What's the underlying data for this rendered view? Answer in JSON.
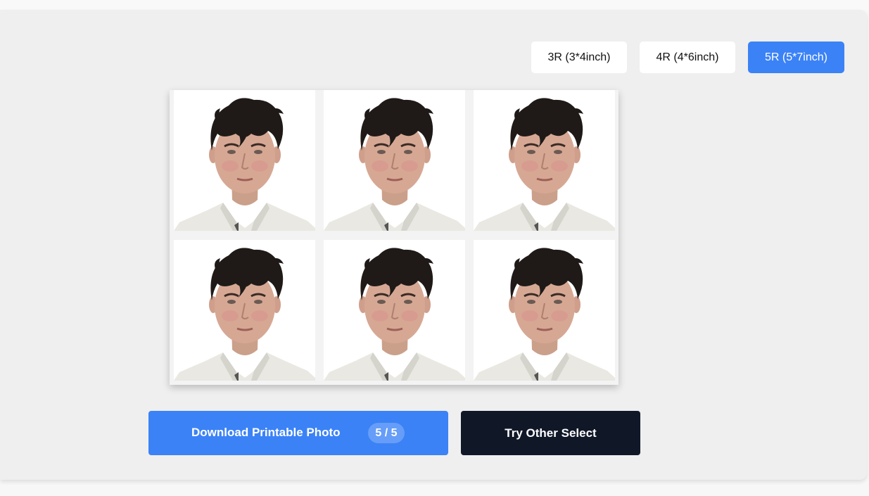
{
  "size_options": [
    {
      "label": "3R (3*4inch)",
      "selected": false
    },
    {
      "label": "4R (4*6inch)",
      "selected": false
    },
    {
      "label": "5R (5*7inch)",
      "selected": true
    }
  ],
  "photo_sheet": {
    "rows": 2,
    "columns": 3,
    "photo_count": 6,
    "photo_description": "passport-style portrait of young man with dark curly hair in white collared shirt on white background"
  },
  "actions": {
    "download_label": "Download Printable Photo",
    "download_count": "5 / 5",
    "try_other_label": "Try Other Select"
  },
  "colors": {
    "accent": "#3b82f6",
    "dark_button": "#101828",
    "panel_background": "#efefef"
  }
}
